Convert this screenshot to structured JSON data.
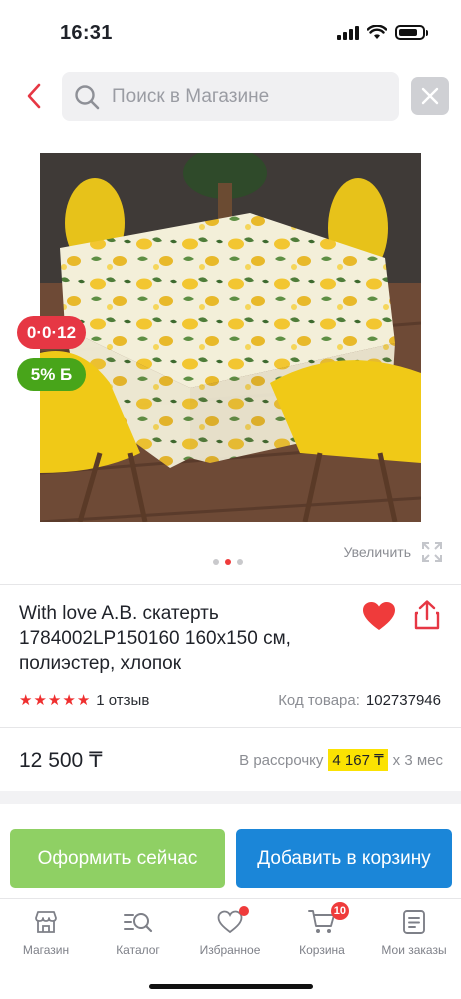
{
  "status_bar": {
    "time": "16:31"
  },
  "search": {
    "placeholder": "Поиск в Магазине"
  },
  "badges": {
    "promo": "0·0·12",
    "bonus": "5% Б"
  },
  "zoom": {
    "label": "Увеличить"
  },
  "carousel": {
    "count": 3,
    "active_index": 1
  },
  "product": {
    "title": "With love A.B. скатерть 1784002LP150160 160x150 см, полиэстер, хлопок",
    "rating_stars": 5,
    "reviews": "1 отзыв",
    "sku_label": "Код товара:",
    "sku": "102737946",
    "price": "12 500 ₸",
    "installment_prefix": "В рассрочку",
    "installment_amount": "4 167 ₸",
    "installment_suffix": "x 3 мес"
  },
  "buttons": {
    "buy_now": "Оформить сейчас",
    "add_to_cart": "Добавить в корзину"
  },
  "tabs": [
    {
      "label": "Магазин",
      "icon": "store-icon"
    },
    {
      "label": "Каталог",
      "icon": "catalog-search-icon"
    },
    {
      "label": "Избранное",
      "icon": "heart-icon",
      "notification": true
    },
    {
      "label": "Корзина",
      "icon": "cart-icon",
      "badge": "10"
    },
    {
      "label": "Мои заказы",
      "icon": "orders-icon"
    }
  ],
  "colors": {
    "accent_red": "#ef3b3b",
    "buy_green": "#8fd064",
    "cart_blue": "#1b86d8",
    "installment_yellow": "#fbe202"
  }
}
